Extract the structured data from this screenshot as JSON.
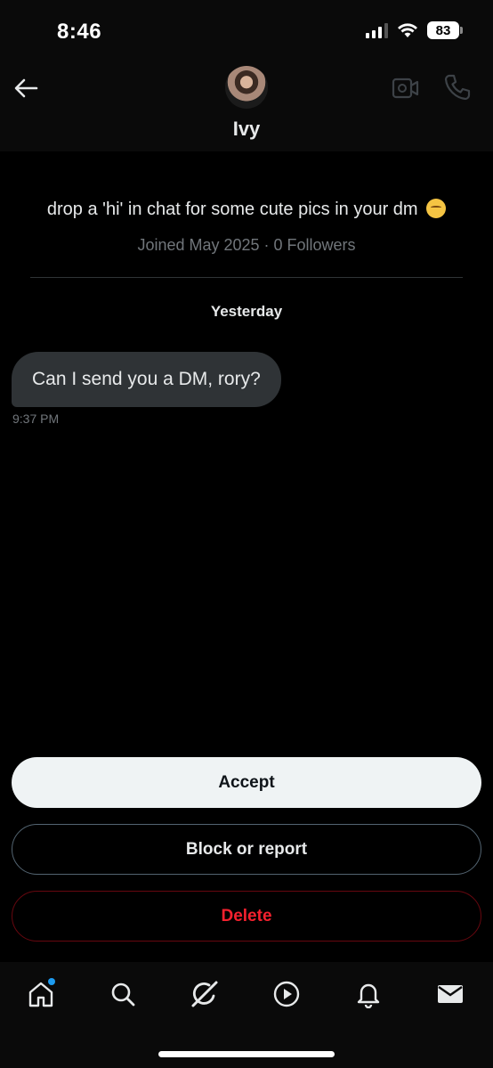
{
  "status_bar": {
    "time": "8:46",
    "battery": "83"
  },
  "header": {
    "name": "Ivy",
    "back_icon": "arrow-left-icon",
    "video_icon": "video-camera-icon",
    "call_icon": "phone-icon"
  },
  "profile": {
    "bio": "drop a 'hi' in chat for some cute pics in your dm",
    "bio_emoji": "kissing-cat-emoji",
    "meta": "Joined May 2025 · 0 Followers"
  },
  "conversation": {
    "date_separator": "Yesterday",
    "messages": [
      {
        "text": "Can I send you a DM, rory?",
        "time": "9:37 PM"
      }
    ]
  },
  "actions": {
    "accept": "Accept",
    "block_report": "Block or report",
    "delete": "Delete"
  },
  "bottom_nav": {
    "items": [
      "home-icon",
      "search-icon",
      "grok-icon",
      "play-icon",
      "bell-icon",
      "mail-icon"
    ],
    "active": "mail-icon",
    "home_notification": true
  },
  "colors": {
    "background": "#000000",
    "bubble": "#2f3336",
    "muted_text": "#71767b",
    "accept_bg": "#eff3f4",
    "delete_text": "#f4212e",
    "notification_dot": "#1d9bf0"
  }
}
